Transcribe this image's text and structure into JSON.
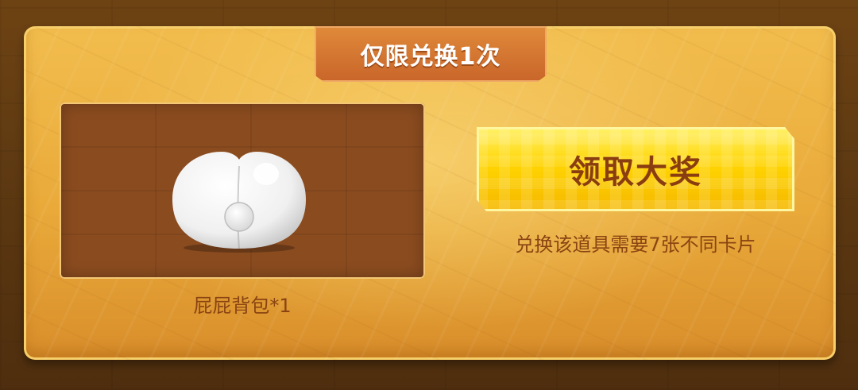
{
  "panel": {
    "limit_tag": "仅限兑换1次",
    "item": {
      "label": "屁屁背包*1",
      "icon": "bun-backpack-icon"
    },
    "claim_button": {
      "label": "领取大奖"
    },
    "hint": "兑换该道具需要7张不同卡片"
  },
  "colors": {
    "panel_gold": "#eeb444",
    "tag_orange": "#d6762f",
    "button_yellow": "#ffd400",
    "text_brown": "#8a4412"
  }
}
